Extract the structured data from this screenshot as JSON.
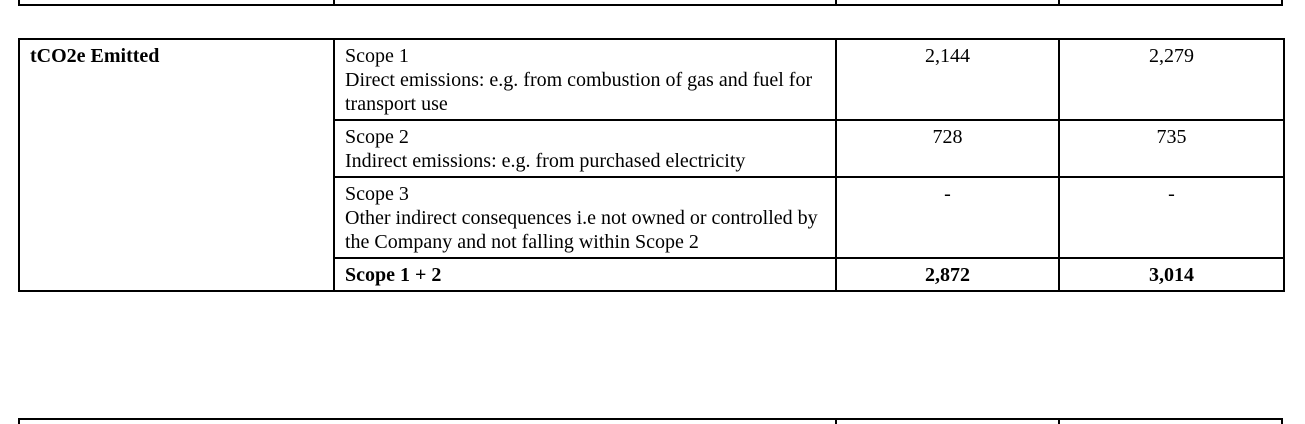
{
  "table": {
    "category_label": "tCO2e Emitted",
    "rows": [
      {
        "title": "Scope 1",
        "description": "Direct emissions: e.g. from combustion of gas and fuel for transport use",
        "value_1": "2,144",
        "value_2": "2,279"
      },
      {
        "title": "Scope 2",
        "description": "Indirect emissions: e.g. from purchased electricity",
        "value_1": "728",
        "value_2": "735"
      },
      {
        "title": "Scope 3",
        "description": "Other indirect consequences i.e not owned or controlled by the Company and not falling within Scope 2",
        "value_1": "-",
        "value_2": "-"
      }
    ],
    "total": {
      "title": "Scope 1 + 2",
      "value_1": "2,872",
      "value_2": "3,014"
    }
  }
}
